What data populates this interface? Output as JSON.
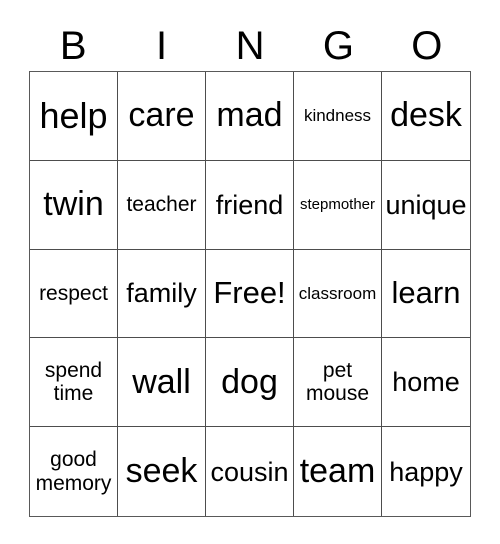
{
  "card": {
    "title_letters": [
      "B",
      "I",
      "N",
      "G",
      "O"
    ],
    "grid": {
      "rows": 5,
      "columns": 5,
      "free_space_label": "Free!",
      "cells": [
        {
          "text": "help",
          "size": "s-xxl"
        },
        {
          "text": "care",
          "size": "s-xl"
        },
        {
          "text": "mad",
          "size": "s-xl"
        },
        {
          "text": "kindness",
          "size": "s-xs"
        },
        {
          "text": "desk",
          "size": "s-xl"
        },
        {
          "text": "twin",
          "size": "s-xl"
        },
        {
          "text": "teacher",
          "size": "s-sm"
        },
        {
          "text": "friend",
          "size": "s-md"
        },
        {
          "text": "stepmother",
          "size": "s-xxs"
        },
        {
          "text": "unique",
          "size": "s-md"
        },
        {
          "text": "respect",
          "size": "s-sm"
        },
        {
          "text": "family",
          "size": "s-md"
        },
        {
          "text": "Free!",
          "size": "s-lg"
        },
        {
          "text": "classroom",
          "size": "s-xs"
        },
        {
          "text": "learn",
          "size": "s-lg"
        },
        {
          "text": "spend\ntime",
          "size": "s-two"
        },
        {
          "text": "wall",
          "size": "s-xl"
        },
        {
          "text": "dog",
          "size": "s-xl"
        },
        {
          "text": "pet\nmouse",
          "size": "s-two"
        },
        {
          "text": "home",
          "size": "s-md"
        },
        {
          "text": "good\nmemory",
          "size": "s-two"
        },
        {
          "text": "seek",
          "size": "s-xl"
        },
        {
          "text": "cousin",
          "size": "s-md"
        },
        {
          "text": "team",
          "size": "s-xl"
        },
        {
          "text": "happy",
          "size": "s-md"
        }
      ]
    },
    "colors": {
      "background": "#ffffff",
      "text": "#000000",
      "grid_outer_border": "#595959",
      "grid_inner_border": "#4d4d4d"
    }
  }
}
